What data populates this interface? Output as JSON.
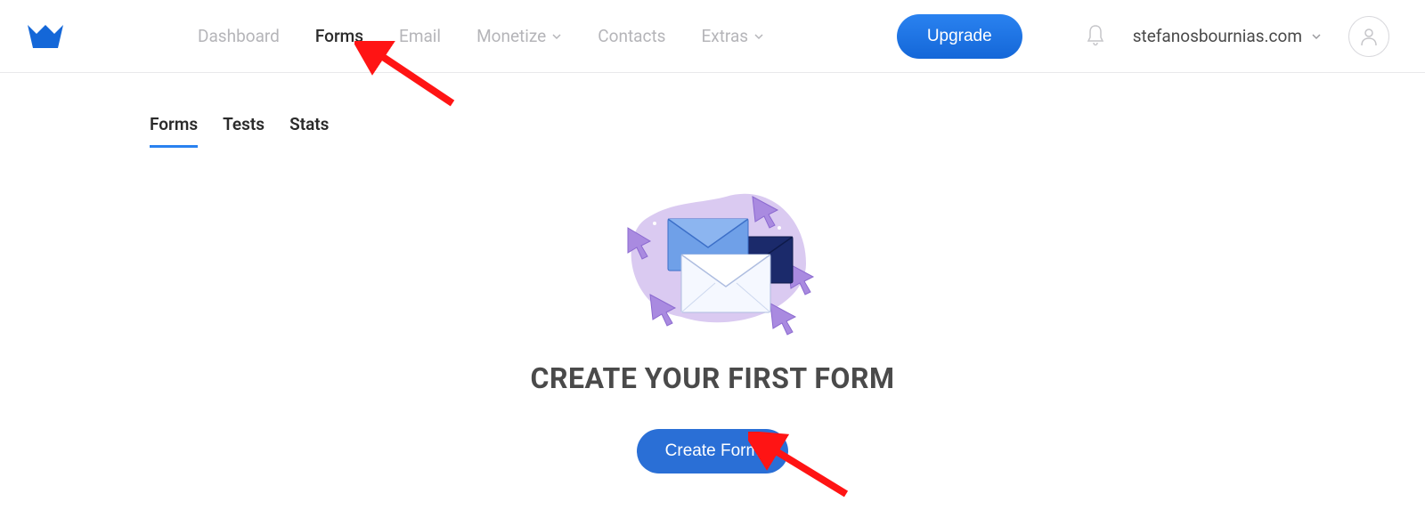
{
  "nav": {
    "dashboard": "Dashboard",
    "forms": "Forms",
    "email": "Email",
    "monetize": "Monetize",
    "contacts": "Contacts",
    "extras": "Extras"
  },
  "upgrade_label": "Upgrade",
  "account_name": "stefanosbournias.com",
  "subnav": {
    "forms": "Forms",
    "tests": "Tests",
    "stats": "Stats"
  },
  "hero": {
    "headline": "CREATE YOUR FIRST FORM",
    "create_label": "Create Form"
  }
}
